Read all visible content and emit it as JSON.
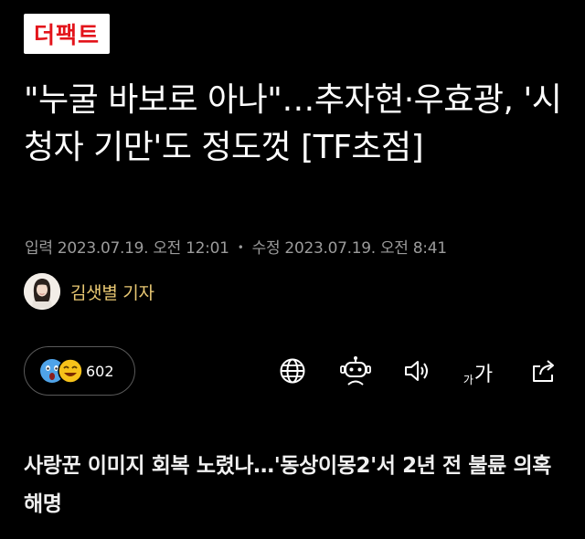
{
  "brand": {
    "logo_text": "더팩트",
    "logo_color": "#e3141b"
  },
  "article": {
    "headline": "\"누굴 바보로 아나\"…추자현·우효광, '시청자 기만'도 정도껏 [TF초점]",
    "published_label": "입력",
    "published": "2023.07.19. 오전 12:01",
    "separator": "•",
    "updated_label": "수정",
    "updated": "2023.07.19. 오전 8:41",
    "author": "김샛별 기자"
  },
  "reactions": {
    "count": "602",
    "icons": [
      "surprised-emoji-icon",
      "laughing-emoji-icon"
    ]
  },
  "toolbar": {
    "items": [
      "globe-icon",
      "robot-icon",
      "speaker-icon",
      "font-size-icon",
      "share-icon"
    ],
    "font_size_small": "가",
    "font_size_big": "가"
  },
  "related": {
    "title": "사랑꾼 이미지 회복 노렸나…'동상이몽2'서 2년 전 불륜 의혹 해명"
  },
  "colors": {
    "background": "#000000",
    "author_accent": "#e9c873",
    "meta_text": "#9b9b9b"
  }
}
